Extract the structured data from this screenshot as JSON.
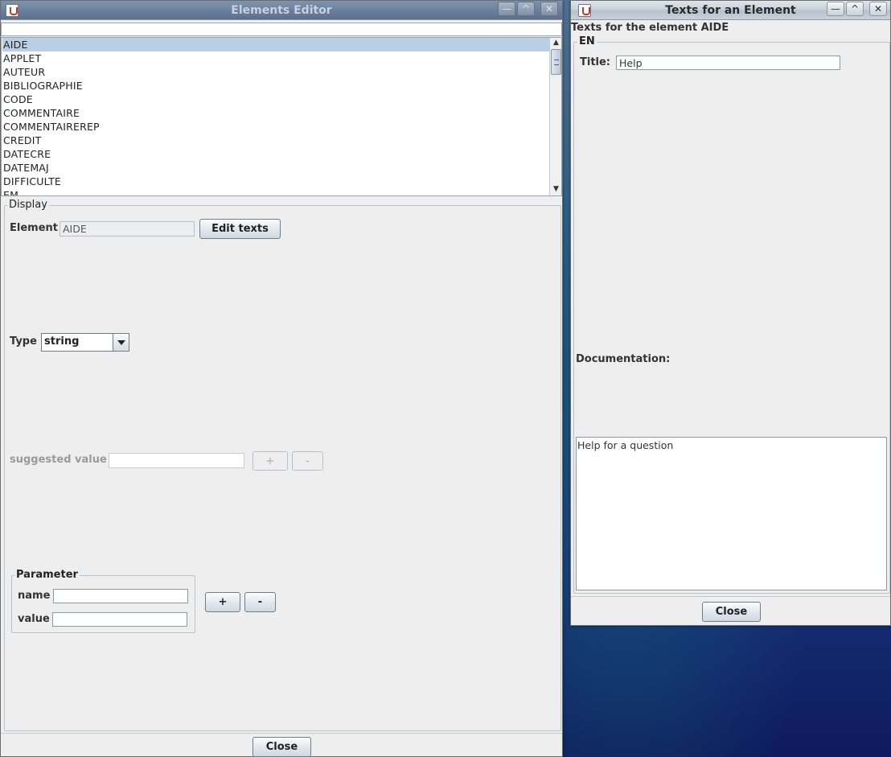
{
  "elements_editor": {
    "title": "Elements Editor",
    "filter_value": "",
    "list_items": [
      {
        "label": "AIDE",
        "selected": true
      },
      {
        "label": "APPLET"
      },
      {
        "label": "AUTEUR"
      },
      {
        "label": "BIBLIOGRAPHIE"
      },
      {
        "label": "CODE"
      },
      {
        "label": "COMMENTAIRE"
      },
      {
        "label": "COMMENTAIREREP"
      },
      {
        "label": "CREDIT"
      },
      {
        "label": "DATECRE"
      },
      {
        "label": "DATEMAJ"
      },
      {
        "label": "DIFFICULTE"
      },
      {
        "label": "EM"
      }
    ],
    "display": {
      "group_title": "Display",
      "element_label": "Element",
      "element_value": "AIDE",
      "edit_texts_button": "Edit texts",
      "type_label": "Type",
      "type_value": "string",
      "suggested_value_label": "suggested value",
      "suggested_value": "",
      "plus_button": "+",
      "minus_button": "-",
      "parameter": {
        "group_title": "Parameter",
        "name_label": "name",
        "name_value": "",
        "value_label": "value",
        "value_value": "",
        "plus_button": "+",
        "minus_button": "-"
      }
    },
    "close_button": "Close"
  },
  "texts_window": {
    "title": "Texts for an Element",
    "heading": "Texts for the element AIDE",
    "lang_group_title": "EN",
    "title_label": "Title:",
    "title_value": "Help",
    "documentation_label": "Documentation:",
    "documentation_value": "Help for a question",
    "close_button": "Close"
  },
  "icons": [
    "java-app-icon",
    "minimize-icon",
    "maximize-icon",
    "close-icon",
    "scroll-up-arrow-icon",
    "scroll-down-arrow-icon",
    "combo-dropdown-arrow-icon"
  ],
  "colors": {
    "selection": "#b8cfe5",
    "window_bg": "#eeeeee",
    "desktop": "#1e3f73"
  }
}
